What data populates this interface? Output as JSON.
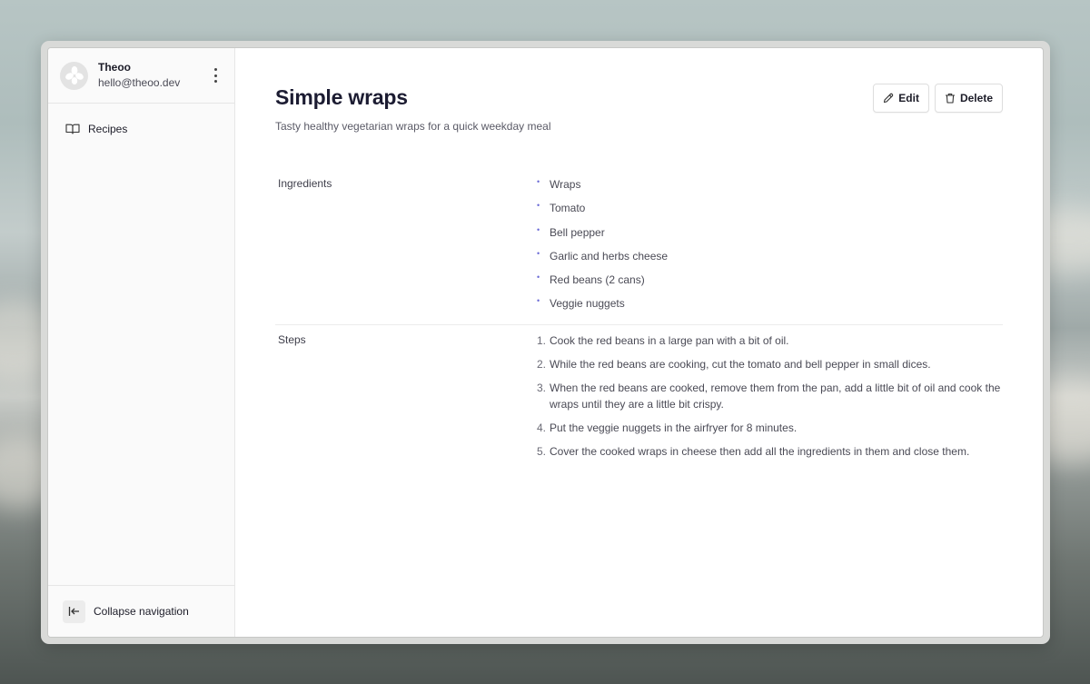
{
  "user": {
    "name": "Theoo",
    "email": "hello@theoo.dev"
  },
  "nav": {
    "items": [
      {
        "label": "Recipes",
        "icon": "book-icon"
      }
    ],
    "collapse_label": "Collapse navigation"
  },
  "recipe": {
    "title": "Simple wraps",
    "subtitle": "Tasty healthy vegetarian wraps for a quick weekday meal",
    "ingredients_label": "Ingredients",
    "ingredients": [
      "Wraps",
      "Tomato",
      "Bell pepper",
      "Garlic and herbs cheese",
      "Red beans (2 cans)",
      "Veggie nuggets"
    ],
    "steps_label": "Steps",
    "steps": [
      {
        "num": "1.",
        "text": "Cook the red beans in a large pan with a bit of oil."
      },
      {
        "num": "2.",
        "text": "While the red beans are cooking, cut the tomato and bell pepper in small dices."
      },
      {
        "num": "3.",
        "text": "When the red beans are cooked, remove them from the pan, add a little bit of oil and cook the wraps until they are a little bit crispy."
      },
      {
        "num": "4.",
        "text": "Put the veggie nuggets in the airfryer for 8 minutes."
      },
      {
        "num": "5.",
        "text": "Cover the cooked wraps in cheese then add all the ingredients in them and close them."
      }
    ]
  },
  "actions": {
    "edit_label": "Edit",
    "delete_label": "Delete"
  },
  "colors": {
    "accent_bullet": "#6b6bd6",
    "title": "#1c1c32"
  }
}
